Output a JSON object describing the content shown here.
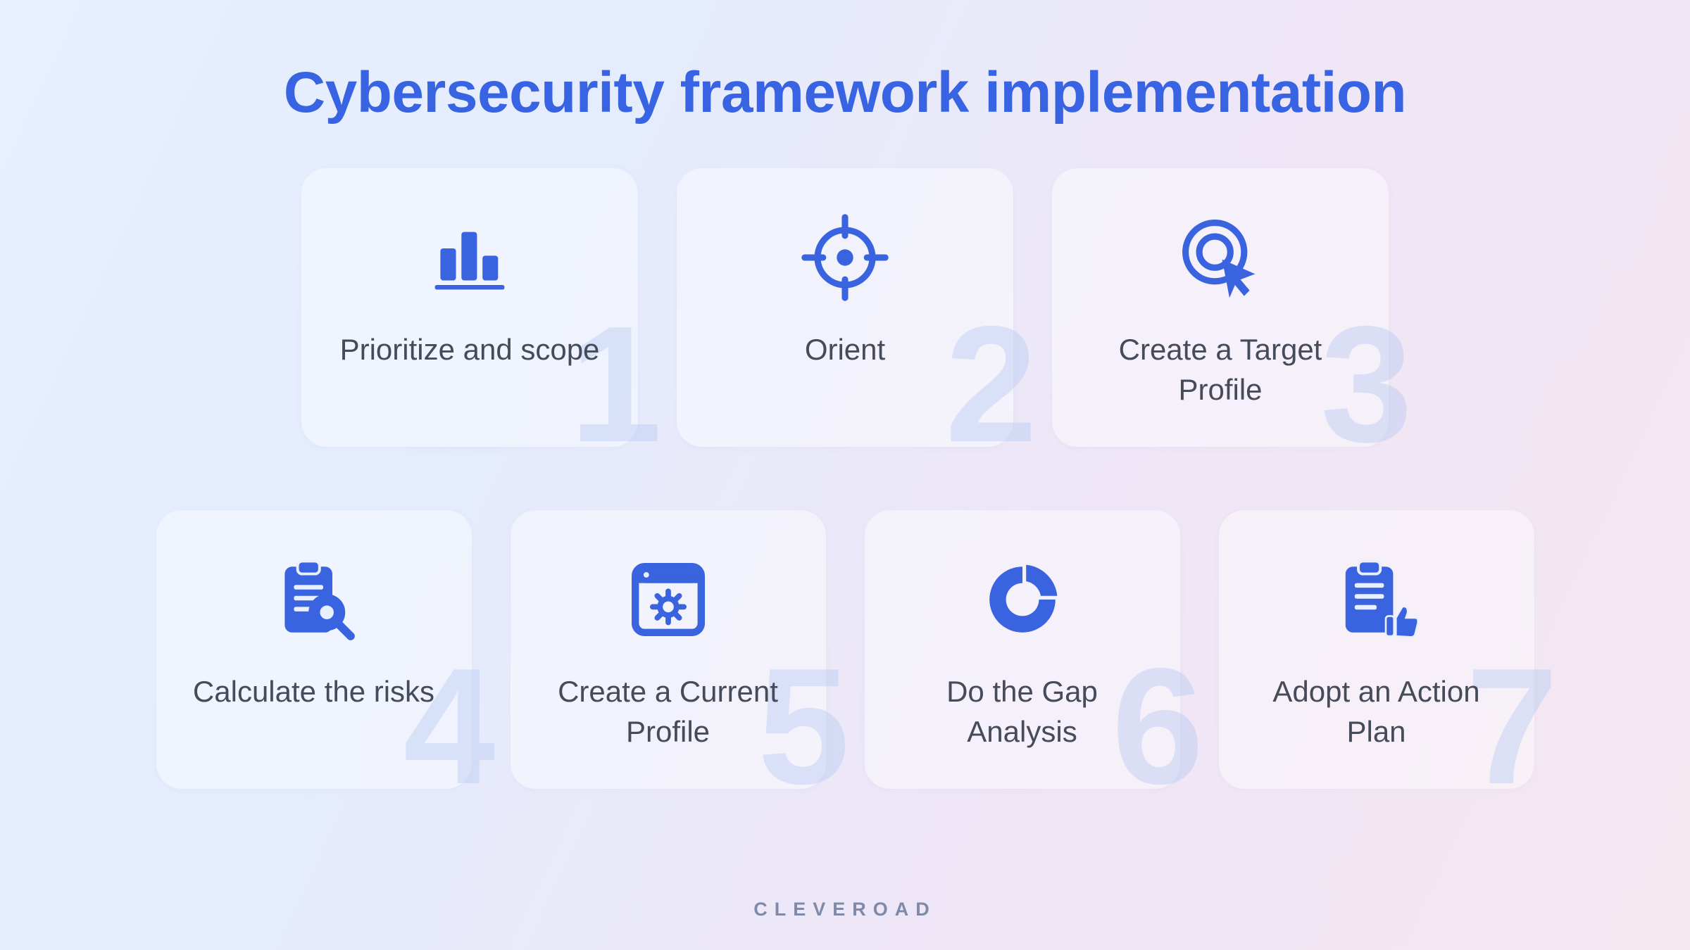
{
  "title": "Cybersecurity framework implementation",
  "footer": "CLEVEROAD",
  "colors": {
    "accent": "#3864e3",
    "icon": "#3a63e0",
    "text": "#454b58",
    "bg_number": "rgba(180,200,240,0.42)"
  },
  "steps": [
    {
      "number": "1",
      "label": "Prioritize and scope",
      "icon": "bar-chart-icon"
    },
    {
      "number": "2",
      "label": "Orient",
      "icon": "crosshair-icon"
    },
    {
      "number": "3",
      "label": "Create a Target Profile",
      "icon": "target-click-icon"
    },
    {
      "number": "4",
      "label": "Calculate the risks",
      "icon": "clipboard-search-icon"
    },
    {
      "number": "5",
      "label": "Create a Current Profile",
      "icon": "window-gear-icon"
    },
    {
      "number": "6",
      "label": "Do the Gap Analysis",
      "icon": "donut-chart-icon"
    },
    {
      "number": "7",
      "label": "Adopt an Action Plan",
      "icon": "clipboard-thumbs-icon"
    }
  ]
}
